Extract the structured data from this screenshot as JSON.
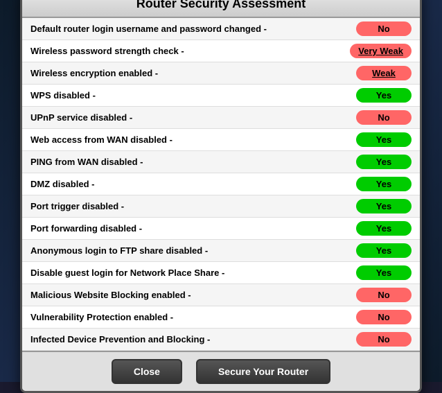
{
  "modal": {
    "title": "Router Security Assessment",
    "rows": [
      {
        "label": "Default router login username and password changed -",
        "status": "No",
        "type": "no"
      },
      {
        "label": "Wireless password strength check -",
        "status": "Very Weak",
        "type": "very-weak"
      },
      {
        "label": "Wireless encryption enabled -",
        "status": "Weak",
        "type": "weak"
      },
      {
        "label": "WPS disabled -",
        "status": "Yes",
        "type": "yes"
      },
      {
        "label": "UPnP service disabled -",
        "status": "No",
        "type": "no"
      },
      {
        "label": "Web access from WAN disabled -",
        "status": "Yes",
        "type": "yes"
      },
      {
        "label": "PING from WAN disabled -",
        "status": "Yes",
        "type": "yes"
      },
      {
        "label": "DMZ disabled -",
        "status": "Yes",
        "type": "yes"
      },
      {
        "label": "Port trigger disabled -",
        "status": "Yes",
        "type": "yes"
      },
      {
        "label": "Port forwarding disabled -",
        "status": "Yes",
        "type": "yes"
      },
      {
        "label": "Anonymous login to FTP share disabled -",
        "status": "Yes",
        "type": "yes"
      },
      {
        "label": "Disable guest login for Network Place Share -",
        "status": "Yes",
        "type": "yes"
      },
      {
        "label": "Malicious Website Blocking enabled -",
        "status": "No",
        "type": "no"
      },
      {
        "label": "Vulnerability Protection enabled -",
        "status": "No",
        "type": "no"
      },
      {
        "label": "Infected Device Prevention and Blocking -",
        "status": "No",
        "type": "no"
      }
    ],
    "footer": {
      "close_label": "Close",
      "secure_label": "Secure Your Router"
    }
  }
}
